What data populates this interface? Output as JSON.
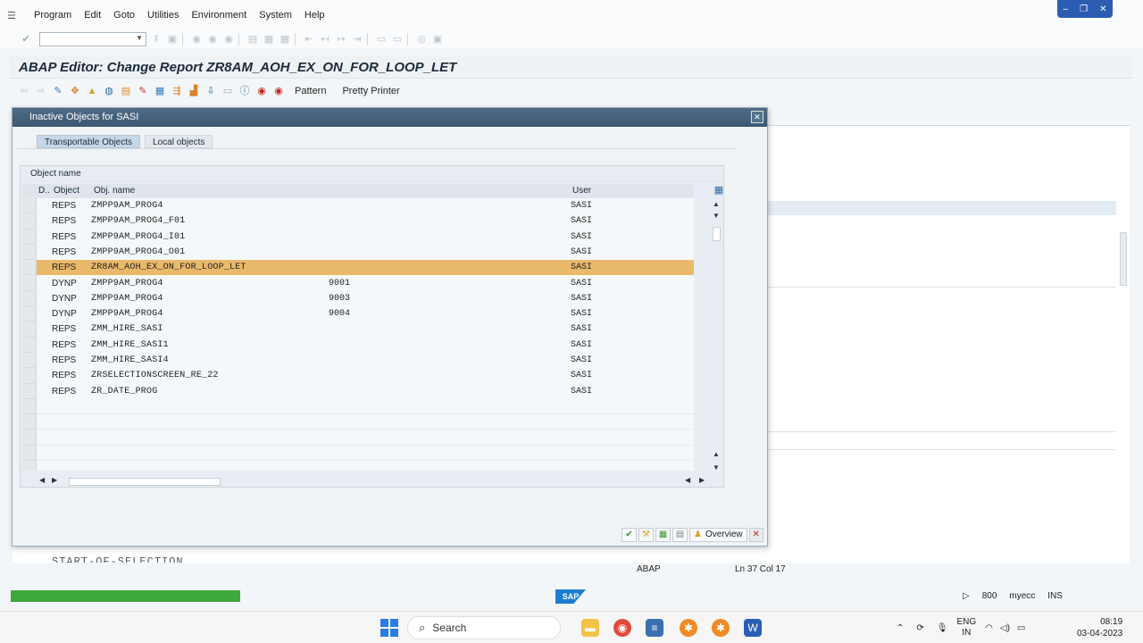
{
  "menu": [
    "Program",
    "Edit",
    "Goto",
    "Utilities",
    "Environment",
    "System",
    "Help"
  ],
  "title": "ABAP Editor: Change Report ZR8AM_AOH_EX_ON_FOR_LOOP_LET",
  "app_toolbar": {
    "pattern_label": "Pattern",
    "pretty_printer_label": "Pretty Printer"
  },
  "dialog": {
    "title": "Inactive Objects for SASI",
    "tabs": [
      "Transportable Objects",
      "Local objects"
    ],
    "group_title": "Object name",
    "columns": {
      "d": "D..",
      "object": "Object",
      "obj_name": "Obj. name",
      "user": "User"
    },
    "rows": [
      {
        "object": "REPS",
        "obj_name": "ZMPP9AM_PROG4",
        "extra": "",
        "user": "SASI"
      },
      {
        "object": "REPS",
        "obj_name": "ZMPP9AM_PROG4_F01",
        "extra": "",
        "user": "SASI"
      },
      {
        "object": "REPS",
        "obj_name": "ZMPP9AM_PROG4_I01",
        "extra": "",
        "user": "SASI"
      },
      {
        "object": "REPS",
        "obj_name": "ZMPP9AM_PROG4_O01",
        "extra": "",
        "user": "SASI"
      },
      {
        "object": "REPS",
        "obj_name": "ZR8AM_AOH_EX_ON_FOR_LOOP_LET",
        "extra": "",
        "user": "SASI",
        "selected": true
      },
      {
        "object": "DYNP",
        "obj_name": "ZMPP9AM_PROG4",
        "extra": "9001",
        "user": "SASI"
      },
      {
        "object": "DYNP",
        "obj_name": "ZMPP9AM_PROG4",
        "extra": "9003",
        "user": "SASI"
      },
      {
        "object": "DYNP",
        "obj_name": "ZMPP9AM_PROG4",
        "extra": "9004",
        "user": "SASI"
      },
      {
        "object": "REPS",
        "obj_name": "ZMM_HIRE_SASI",
        "extra": "",
        "user": "SASI"
      },
      {
        "object": "REPS",
        "obj_name": "ZMM_HIRE_SASI1",
        "extra": "",
        "user": "SASI"
      },
      {
        "object": "REPS",
        "obj_name": "ZMM_HIRE_SASI4",
        "extra": "",
        "user": "SASI"
      },
      {
        "object": "REPS",
        "obj_name": "ZRSELECTIONSCREEN_RE_22",
        "extra": "",
        "user": "SASI"
      },
      {
        "object": "REPS",
        "obj_name": "ZR_DATE_PROG",
        "extra": "",
        "user": "SASI"
      }
    ],
    "footer_overview_label": "Overview"
  },
  "editor": {
    "code_line": "START-OF-SELECTION."
  },
  "status": {
    "mode": "ABAP",
    "position": "Ln 37 Col 17"
  },
  "sap_status": {
    "logo": "SAP",
    "client": "800",
    "system": "myecc",
    "ins": "INS"
  },
  "taskbar": {
    "search_label": "Search",
    "lang_top": "ENG",
    "lang_bottom": "IN",
    "time": "08:19",
    "date": "03-04-2023"
  },
  "colors": {
    "selected_row": "#e9b96b",
    "title_bar": "#4d6b86",
    "progress": "#3fa83a"
  }
}
